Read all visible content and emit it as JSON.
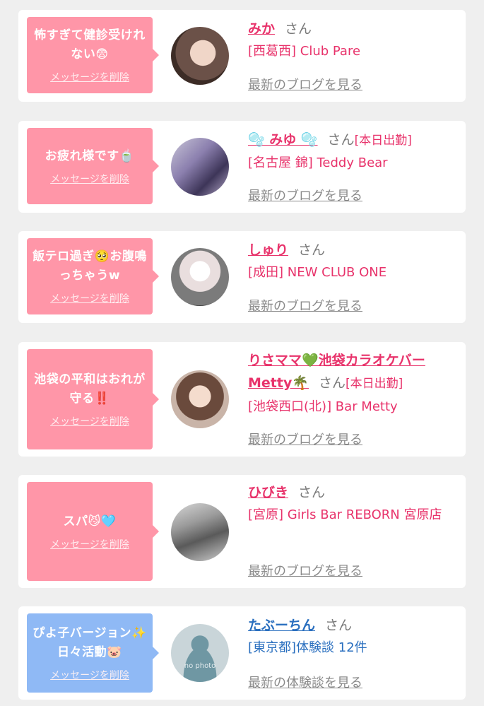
{
  "delete_label": "メッセージを削除",
  "cards": [
    {
      "message": "怖すぎて健診受けれない😨",
      "name": "みか",
      "san": "さん",
      "work": "",
      "shop": "[西葛西] Club Pare",
      "blog": "最新のブログを見る"
    },
    {
      "message": "お疲れ様です🍵",
      "name": "🫧 みゆ 🫧",
      "san": "さん",
      "work": "[本日出勤]",
      "shop": "[名古屋 錦] Teddy Bear",
      "blog": "最新のブログを見る"
    },
    {
      "message": "飯テロ過ぎ🥺お腹鳴っちゃうw",
      "name": "しゅり",
      "san": "さん",
      "work": "",
      "shop": "[成田] NEW CLUB ONE",
      "blog": "最新のブログを見る"
    },
    {
      "message": "池袋の平和はおれが守る‼️",
      "name": "りさママ💚池袋カラオケバーMetty🌴",
      "san": "さん",
      "work": "[本日出勤]",
      "shop": "[池袋西口(北)] Bar Metty",
      "blog": "最新のブログを見る"
    },
    {
      "message": "スパ😼🩵",
      "name": "ひびき",
      "san": "さん",
      "work": "",
      "shop": "[宮原] Girls Bar REBORN 宮原店",
      "blog": "最新のブログを見る"
    },
    {
      "message": "ぴよ子バージョン✨日々活動🐷",
      "name": "たぶーちん",
      "san": "さん",
      "work": "",
      "shop": "[東京都]体験談 12件",
      "blog": "最新の体験談を見る",
      "no_photo": "no photo"
    }
  ],
  "colors": {
    "pink_bubble": "#ff96a8",
    "blue_bubble": "#8fb9f5",
    "name_pink": "#e8336b",
    "name_blue": "#2a6fbf",
    "background": "#efefef"
  }
}
